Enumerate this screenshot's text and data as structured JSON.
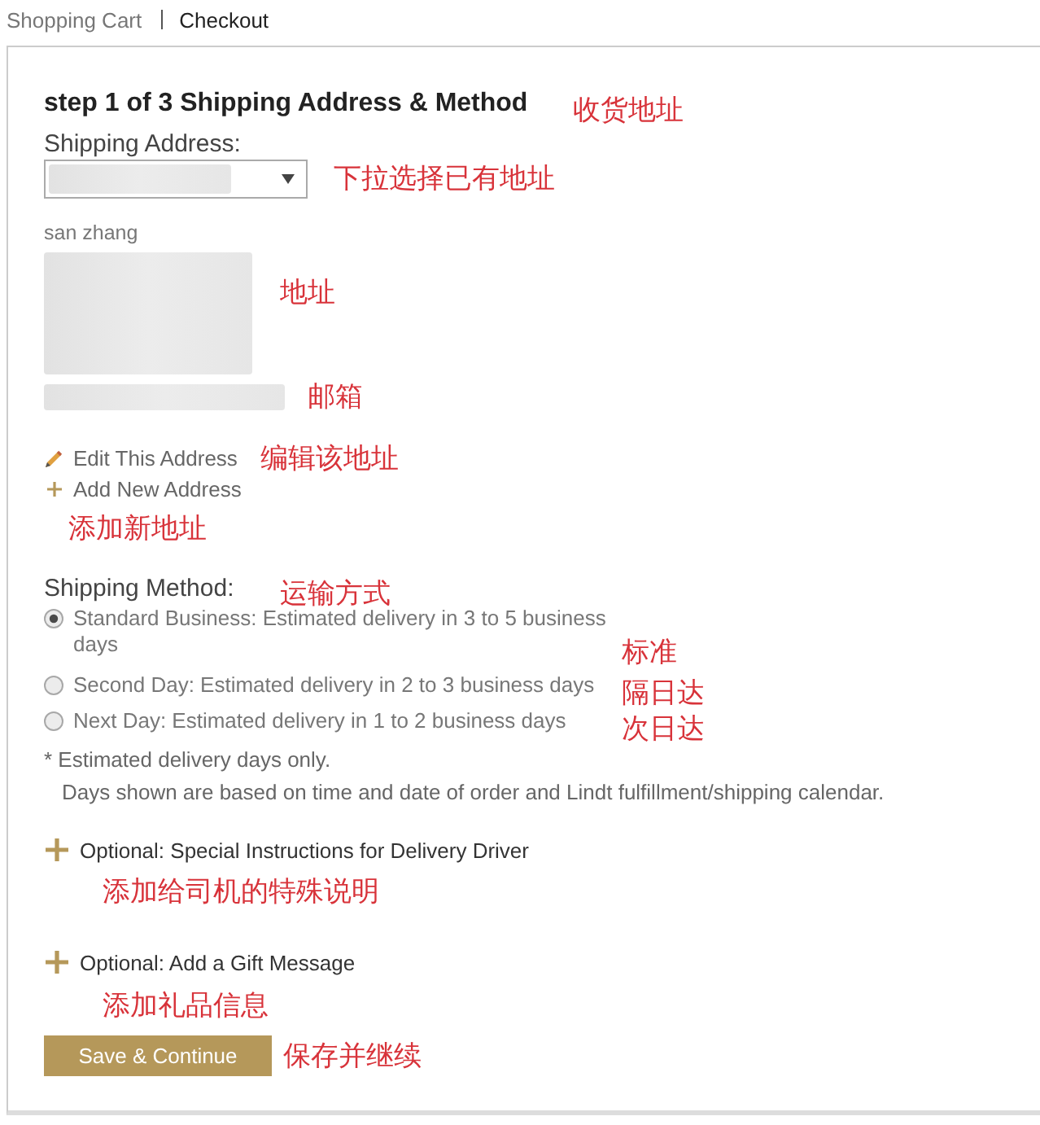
{
  "breadcrumb": [
    {
      "label": "Shopping Cart",
      "selected": false
    },
    {
      "label": "Checkout",
      "selected": true
    }
  ],
  "step": {
    "title": "step 1 of 3 Shipping Address & Method",
    "note": "收货地址"
  },
  "shipping_address": {
    "label": "Shipping Address:",
    "dropdown_note": "下拉选择已有地址",
    "name": "san zhang",
    "address_note": "地址",
    "email_note": "邮箱"
  },
  "address_actions": [
    {
      "kind": "edit",
      "label": "Edit This Address",
      "note": "编辑该地址"
    },
    {
      "kind": "add",
      "label": "Add New Address",
      "note": "添加新地址"
    }
  ],
  "shipping_method": {
    "label": "Shipping Method:",
    "note": "运输方式",
    "options": [
      {
        "label": "Standard Business: Estimated delivery in 3 to 5 business days",
        "selected": true,
        "note": "标准"
      },
      {
        "label": "Second Day: Estimated delivery in 2 to 3 business days",
        "selected": false,
        "note": "隔日达"
      },
      {
        "label": "Next Day: Estimated delivery in 1 to 2 business days",
        "selected": false,
        "note": "次日达"
      }
    ],
    "footnote": [
      "* Estimated delivery days only.",
      "Days shown are based on time and date of order and Lindt fulfillment/shipping calendar."
    ]
  },
  "optional_sections": [
    {
      "label": "Optional: Special Instructions for Delivery Driver",
      "note": "添加给司机的特殊说明"
    },
    {
      "label": "Optional: Add a Gift Message",
      "note": "添加礼品信息"
    }
  ],
  "submit": {
    "label": "Save & Continue",
    "note": "保存并继续"
  }
}
